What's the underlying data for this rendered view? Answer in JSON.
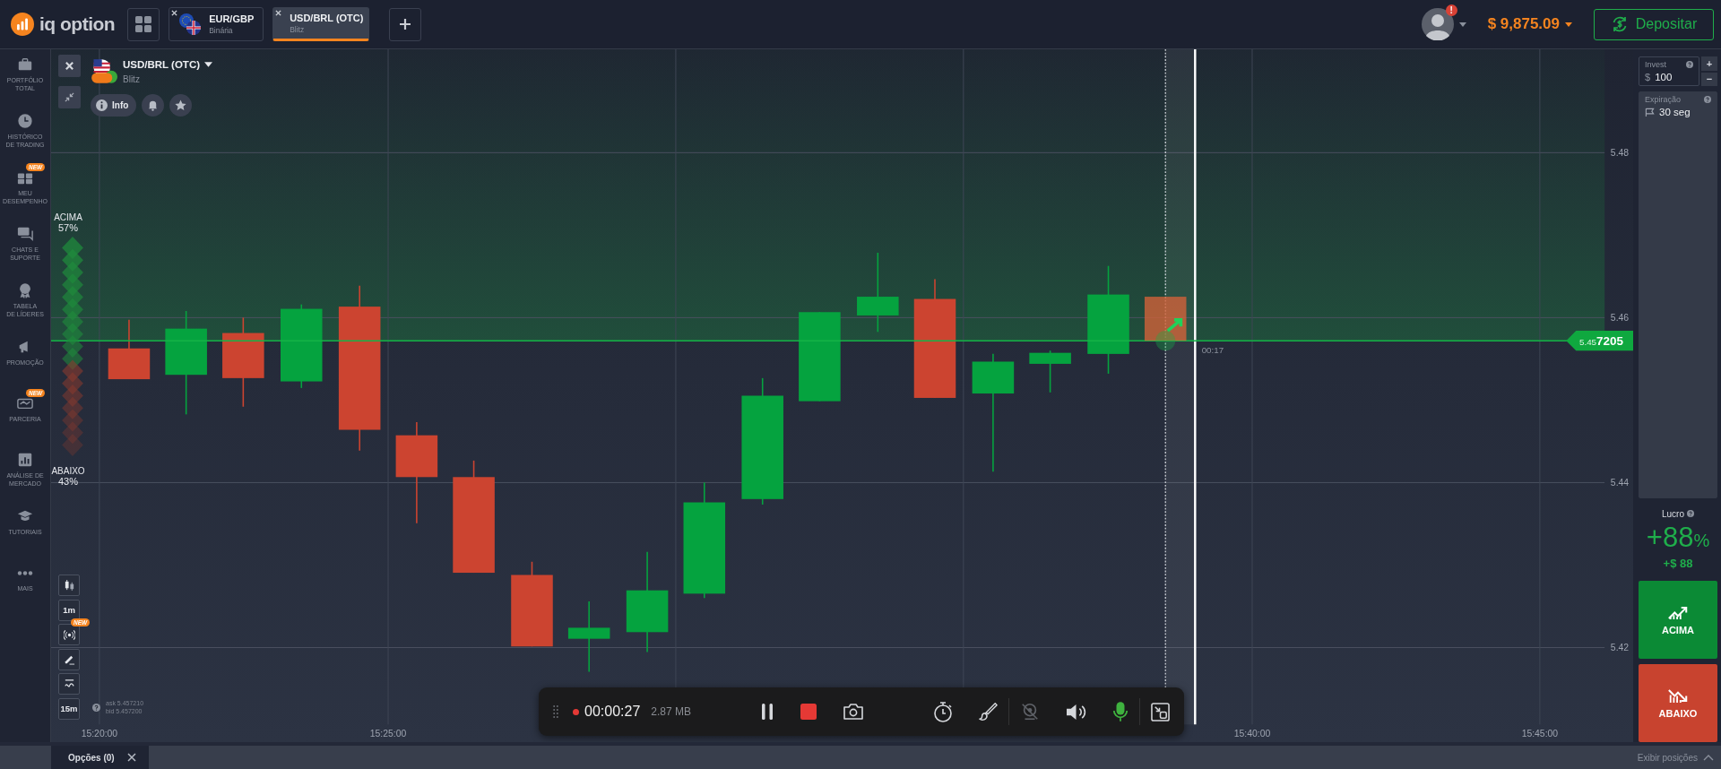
{
  "header": {
    "logo": "iq option",
    "asset_tabs": [
      {
        "name": "EUR/GBP",
        "type": "Binária",
        "selected": false
      },
      {
        "name": "USD/BRL (OTC)",
        "type": "Blitz",
        "selected": true
      }
    ],
    "notification_badge": "!",
    "balance": "$ 9,875.09",
    "deposit_button": "Depositar"
  },
  "sidebar": {
    "items": [
      {
        "label": "PORTFÓLIO\nTOTAL"
      },
      {
        "label": "HISTÓRICO\nDE TRADING"
      },
      {
        "label": "MEU\nDESEMPENHO",
        "badge": "NEW"
      },
      {
        "label": "CHATS E\nSUPORTE"
      },
      {
        "label": "TABELA\nDE LÍDERES"
      },
      {
        "label": "PROMOÇÃO"
      },
      {
        "label": "PARCERIA",
        "badge": "NEW"
      },
      {
        "label": "ANÁLISE DE\nMERCADO"
      },
      {
        "label": "TUTORIAIS"
      },
      {
        "label": "MAIS"
      }
    ]
  },
  "chart": {
    "asset": {
      "name": "USD/BRL (OTC)",
      "type": "Blitz"
    },
    "info_button": "Info",
    "sentiment": {
      "up_label": "ACIMA",
      "up_percent": "57%",
      "down_label": "ABAIXO",
      "down_percent": "43%"
    },
    "price_ticks": [
      "5.48",
      "5.46",
      "5.44",
      "5.42"
    ],
    "time_ticks": [
      "15:20:00",
      "15:25:00",
      "15:40:00",
      "15:45:00"
    ],
    "current_price": {
      "lead": "5.45",
      "tail": "7205"
    },
    "countdown": "00:17",
    "tools": [
      {
        "kind": "icon"
      },
      {
        "kind": "text",
        "label": "1m"
      },
      {
        "kind": "icon",
        "badge": "NEW"
      },
      {
        "kind": "icon"
      },
      {
        "kind": "icon"
      },
      {
        "kind": "text",
        "label": "15m"
      }
    ],
    "ask": "ask 5.457210",
    "bid": "bid 5.457200"
  },
  "trade_panel": {
    "invest": {
      "label": "Invest",
      "currency": "$",
      "value": "100"
    },
    "increase": "+",
    "decrease": "−",
    "expiration": {
      "label": "Expiração",
      "value": "30 seg"
    },
    "profit": {
      "label": "Lucro",
      "percent": "+88",
      "percent_sign": "%",
      "amount": "+$ 88"
    },
    "up_button": "ACIMA",
    "down_button": "ABAIXO"
  },
  "recorder": {
    "recording": true,
    "elapsed": "00:00:27",
    "size": "2.87 MB",
    "webcam_on": false,
    "mic_on": true
  },
  "bottom_bar": {
    "tab": "Opções (0)",
    "show_positions": "Exibir posições"
  }
}
